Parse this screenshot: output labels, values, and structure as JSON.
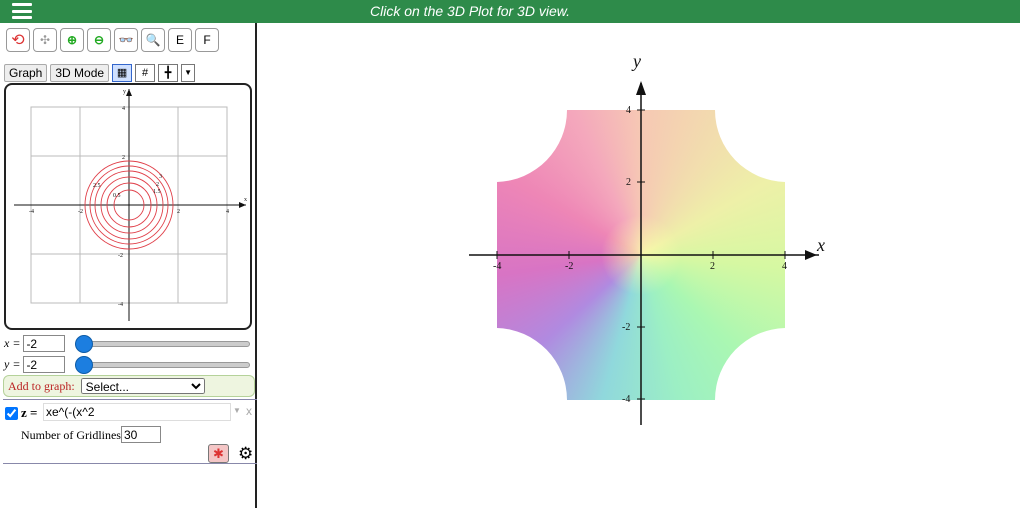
{
  "topbar": {
    "message": "Click on the 3D Plot for 3D view.",
    "menu_icon": "hamburger-icon"
  },
  "toolbar": {
    "buttons": [
      "rotate-icon",
      "axes-icon",
      "zoom-in-icon",
      "zoom-out-icon",
      "3d-glasses-icon",
      "magnifier-icon"
    ],
    "e_label": "E",
    "f_label": "F"
  },
  "tabs": {
    "graph": "Graph",
    "mode3d": "3D Mode"
  },
  "minigraph": {
    "x_label": "x",
    "y_label": "y",
    "ticks": [
      "-4",
      "-2",
      "2",
      "4"
    ],
    "y_ticks": [
      "4",
      "2",
      "-2",
      "-4"
    ],
    "contour_labels": [
      "0.5",
      "1.5",
      "2",
      "2.5",
      "3"
    ],
    "contour_color": "#e0404a"
  },
  "x_slider": {
    "label": "x =",
    "value": "-2",
    "level": 0
  },
  "y_slider": {
    "label": "y =",
    "value": "-2",
    "level": 0
  },
  "add_to_graph": {
    "label": "Add to graph:",
    "selected": "Select..."
  },
  "function": {
    "checked": true,
    "label": "z =",
    "value": "xe^(-(x^2",
    "close": "x",
    "gridlines_label": "Number of Gridlines",
    "gridlines_value": "30"
  },
  "plot": {
    "x_label": "x",
    "y_label": "y",
    "x_ticks": [
      "-4",
      "-2",
      "2",
      "4"
    ],
    "y_ticks": [
      "4",
      "2",
      "-2",
      "-4"
    ]
  }
}
